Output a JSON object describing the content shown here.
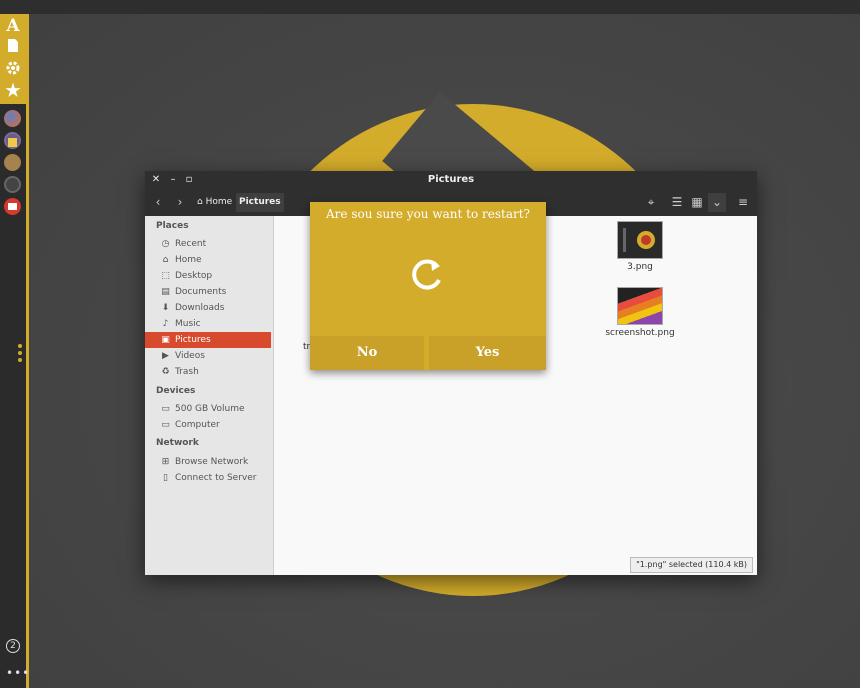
{
  "window": {
    "title": "Pictures",
    "breadcrumb": {
      "home": "Home",
      "current": "Pictures"
    }
  },
  "sidebar": {
    "places_heading": "Places",
    "places": [
      {
        "label": "Recent",
        "icon": "clock-icon"
      },
      {
        "label": "Home",
        "icon": "home-icon"
      },
      {
        "label": "Desktop",
        "icon": "desktop-icon"
      },
      {
        "label": "Documents",
        "icon": "documents-icon"
      },
      {
        "label": "Downloads",
        "icon": "downloads-icon"
      },
      {
        "label": "Music",
        "icon": "music-icon"
      },
      {
        "label": "Pictures",
        "icon": "pictures-icon",
        "selected": true
      },
      {
        "label": "Videos",
        "icon": "videos-icon"
      },
      {
        "label": "Trash",
        "icon": "trash-icon"
      }
    ],
    "devices_heading": "Devices",
    "devices": [
      {
        "label": "500 GB Volume",
        "icon": "drive-icon"
      },
      {
        "label": "Computer",
        "icon": "computer-icon"
      }
    ],
    "network_heading": "Network",
    "network": [
      {
        "label": "Browse Network",
        "icon": "network-icon"
      },
      {
        "label": "Connect to Server",
        "icon": "server-icon"
      }
    ]
  },
  "files": [
    {
      "name": "3.png"
    },
    {
      "name": "screenshot.png"
    },
    {
      "name": "triangles.png"
    }
  ],
  "status": "\"1.png\" selected  (110.4 kB)",
  "dialog": {
    "title": "Are sou sure you want to restart?",
    "no_label": "No",
    "yes_label": "Yes",
    "icon": "restart-icon"
  },
  "dock": {
    "workspace_number": "2",
    "more_label": "•••"
  },
  "colors": {
    "accent": "#d4ac2b",
    "selection": "#d84a2e",
    "dark": "#2f2f2f"
  }
}
